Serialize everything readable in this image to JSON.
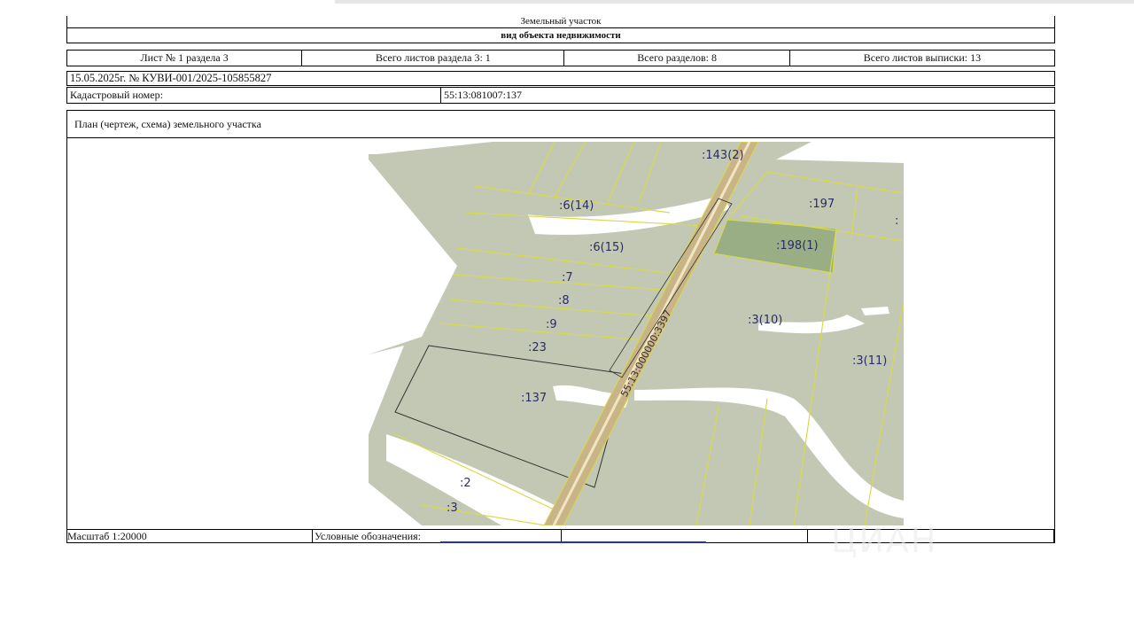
{
  "header": {
    "title": "Земельный участок",
    "subtitle": "вид объекта недвижимости"
  },
  "sheets": {
    "sheet_section": "Лист № 1 раздела 3",
    "total_section_sheets": "Всего листов раздела 3: 1",
    "total_sections": "Всего разделов: 8",
    "total_extract_sheets": "Всего листов выписки: 13"
  },
  "extract": {
    "date_number": "15.05.2025г. № КУВИ-001/2025-105855827"
  },
  "cadastral": {
    "label": "Кадастровый номер:",
    "value": "55:13:081007:137"
  },
  "plan": {
    "label": "План (чертеж, схема) земельного участка",
    "road_label": "55:13:000000:3397",
    "parcels": [
      ":143(2)",
      ":6(14)",
      ":197",
      ":6(15)",
      ":198(1)",
      ":7",
      ":8",
      ":9",
      ":23",
      ":3(10)",
      ":3(11)",
      ":137",
      ":2",
      ":3",
      ":"
    ],
    "colors": {
      "field": "#c3c8b4",
      "highlight": "#9aae86",
      "boundary": "#d8da4a",
      "road": "#c9b488",
      "road_center": "#f0e6c2",
      "river": "#ffffff"
    }
  },
  "footer": {
    "scale": "Масштаб 1:20000",
    "legend_label": "Условные обозначения:"
  },
  "watermark": "ЦИАН"
}
